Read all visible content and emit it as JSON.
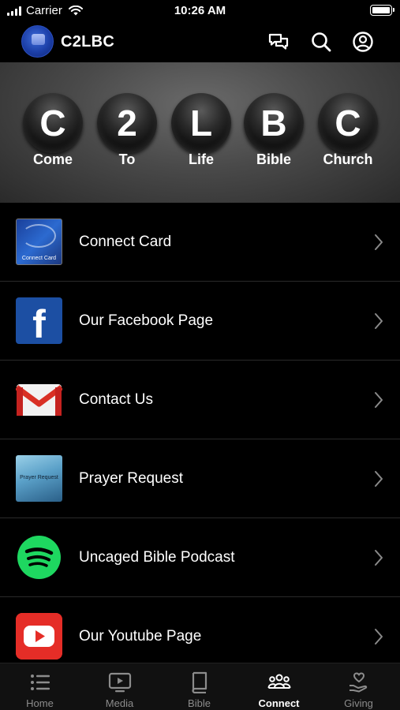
{
  "status_bar": {
    "carrier": "Carrier",
    "time": "10:26 AM"
  },
  "header": {
    "title": "C2LBC",
    "icons": [
      "chat-icon",
      "search-icon",
      "profile-icon"
    ]
  },
  "banner": {
    "letters": [
      {
        "letter": "C",
        "word": "Come"
      },
      {
        "letter": "2",
        "word": "To"
      },
      {
        "letter": "L",
        "word": "Life"
      },
      {
        "letter": "B",
        "word": "Bible"
      },
      {
        "letter": "C",
        "word": "Church"
      }
    ]
  },
  "list": {
    "items": [
      {
        "label": "Connect Card",
        "thumb_text": "Connect Card"
      },
      {
        "label": "Our Facebook Page"
      },
      {
        "label": "Contact Us"
      },
      {
        "label": "Prayer Request",
        "thumb_text": "Prayer Request"
      },
      {
        "label": "Uncaged Bible Podcast"
      },
      {
        "label": "Our Youtube Page"
      }
    ]
  },
  "tabbar": {
    "tabs": [
      {
        "label": "Home",
        "icon": "list-icon"
      },
      {
        "label": "Media",
        "icon": "tv-play-icon"
      },
      {
        "label": "Bible",
        "icon": "book-icon"
      },
      {
        "label": "Connect",
        "icon": "people-icon"
      },
      {
        "label": "Giving",
        "icon": "hand-heart-icon"
      }
    ],
    "active": "Connect"
  },
  "colors": {
    "background": "#000000",
    "facebook": "#1c4fa3",
    "spotify": "#1ed760",
    "youtube": "#e52d27",
    "inactive_tab": "#8c8c8c"
  }
}
